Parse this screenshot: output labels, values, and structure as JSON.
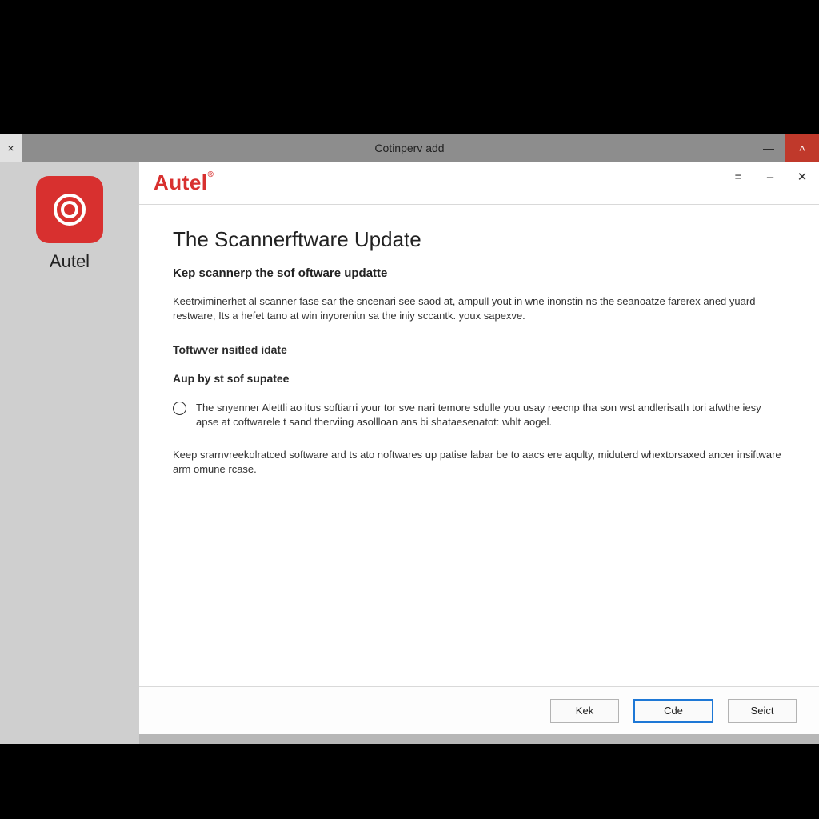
{
  "outer_window": {
    "title": "Cotinperv add",
    "close_x": "×",
    "minimize": "—",
    "caret_up": "˄"
  },
  "sidebar": {
    "brand": "Autel"
  },
  "dialog": {
    "brand": "Autel",
    "brand_mark": "®",
    "controls": {
      "custom": "=",
      "min": "–",
      "close": "✕"
    }
  },
  "content": {
    "title": "The Scannerftware Update",
    "subtitle": "Kep scannerp the sof oftware updatte",
    "intro": "Keetrximinerhet al scanner fase sar the sncenari see saod at, ampull yout in wne inonstin ns the seanoatze farerex aned yuard restware, Its a hefet tano at win inyorenitn sa the iniy sccantk. youx sapexve.",
    "section1_heading": "Toftwver nsitled idate",
    "section2_heading": "Aup by st sof supatee",
    "radio_text": "The snyenner Alettli ao itus softiarri your tor sve nari temore sdulle you usay reecnp tha son wst andlerisath tori afwthe iesy apse at coftwarele t sand therviing asollloan ans bi shataesenatot: whlt aogel.",
    "closing": "Keep srarnvreekolratced software ard ts ato noftwares up patise labar be to aacs ere aqulty, miduterd whextorsaxed ancer insiftware arm omune rcase."
  },
  "footer": {
    "button1": "Kek",
    "button_primary": "Cde",
    "button3": "Seict"
  }
}
